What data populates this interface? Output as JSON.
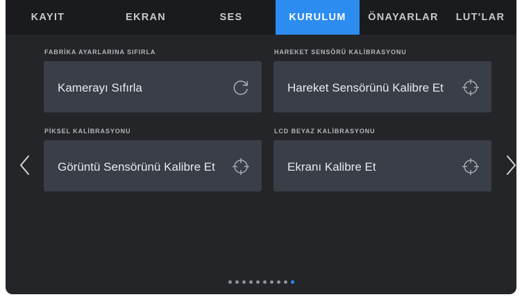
{
  "tabs": [
    {
      "label": "KAYIT"
    },
    {
      "label": "EKRAN"
    },
    {
      "label": "SES"
    },
    {
      "label": "KURULUM"
    },
    {
      "label": "ÖNAYARLAR"
    },
    {
      "label": "LUT'LAR"
    }
  ],
  "active_tab": "KURULUM",
  "sections": {
    "factory_reset": {
      "heading": "FABRİKA AYARLARINA SIFIRLA",
      "button_label": "Kamerayı Sıfırla",
      "icon": "reset-icon"
    },
    "motion_sensor": {
      "heading": "HAREKET SENSÖRÜ KALİBRASYONU",
      "button_label": "Hareket Sensörünü Kalibre Et",
      "icon": "crosshair-icon"
    },
    "pixel_calibration": {
      "heading": "PİKSEL KALİBRASYONU",
      "button_label": "Görüntü Sensörünü Kalibre Et",
      "icon": "crosshair-icon"
    },
    "lcd_white": {
      "heading": "LCD BEYAZ KALİBRASYONU",
      "button_label": "Ekranı Kalibre Et",
      "icon": "crosshair-icon"
    }
  },
  "pagination": {
    "total_pages": 10,
    "current_page": 10
  },
  "colors": {
    "accent": "#2c8cf0",
    "background": "#232529",
    "tab_bar": "#1a1b1e",
    "card": "#3a3e47"
  }
}
